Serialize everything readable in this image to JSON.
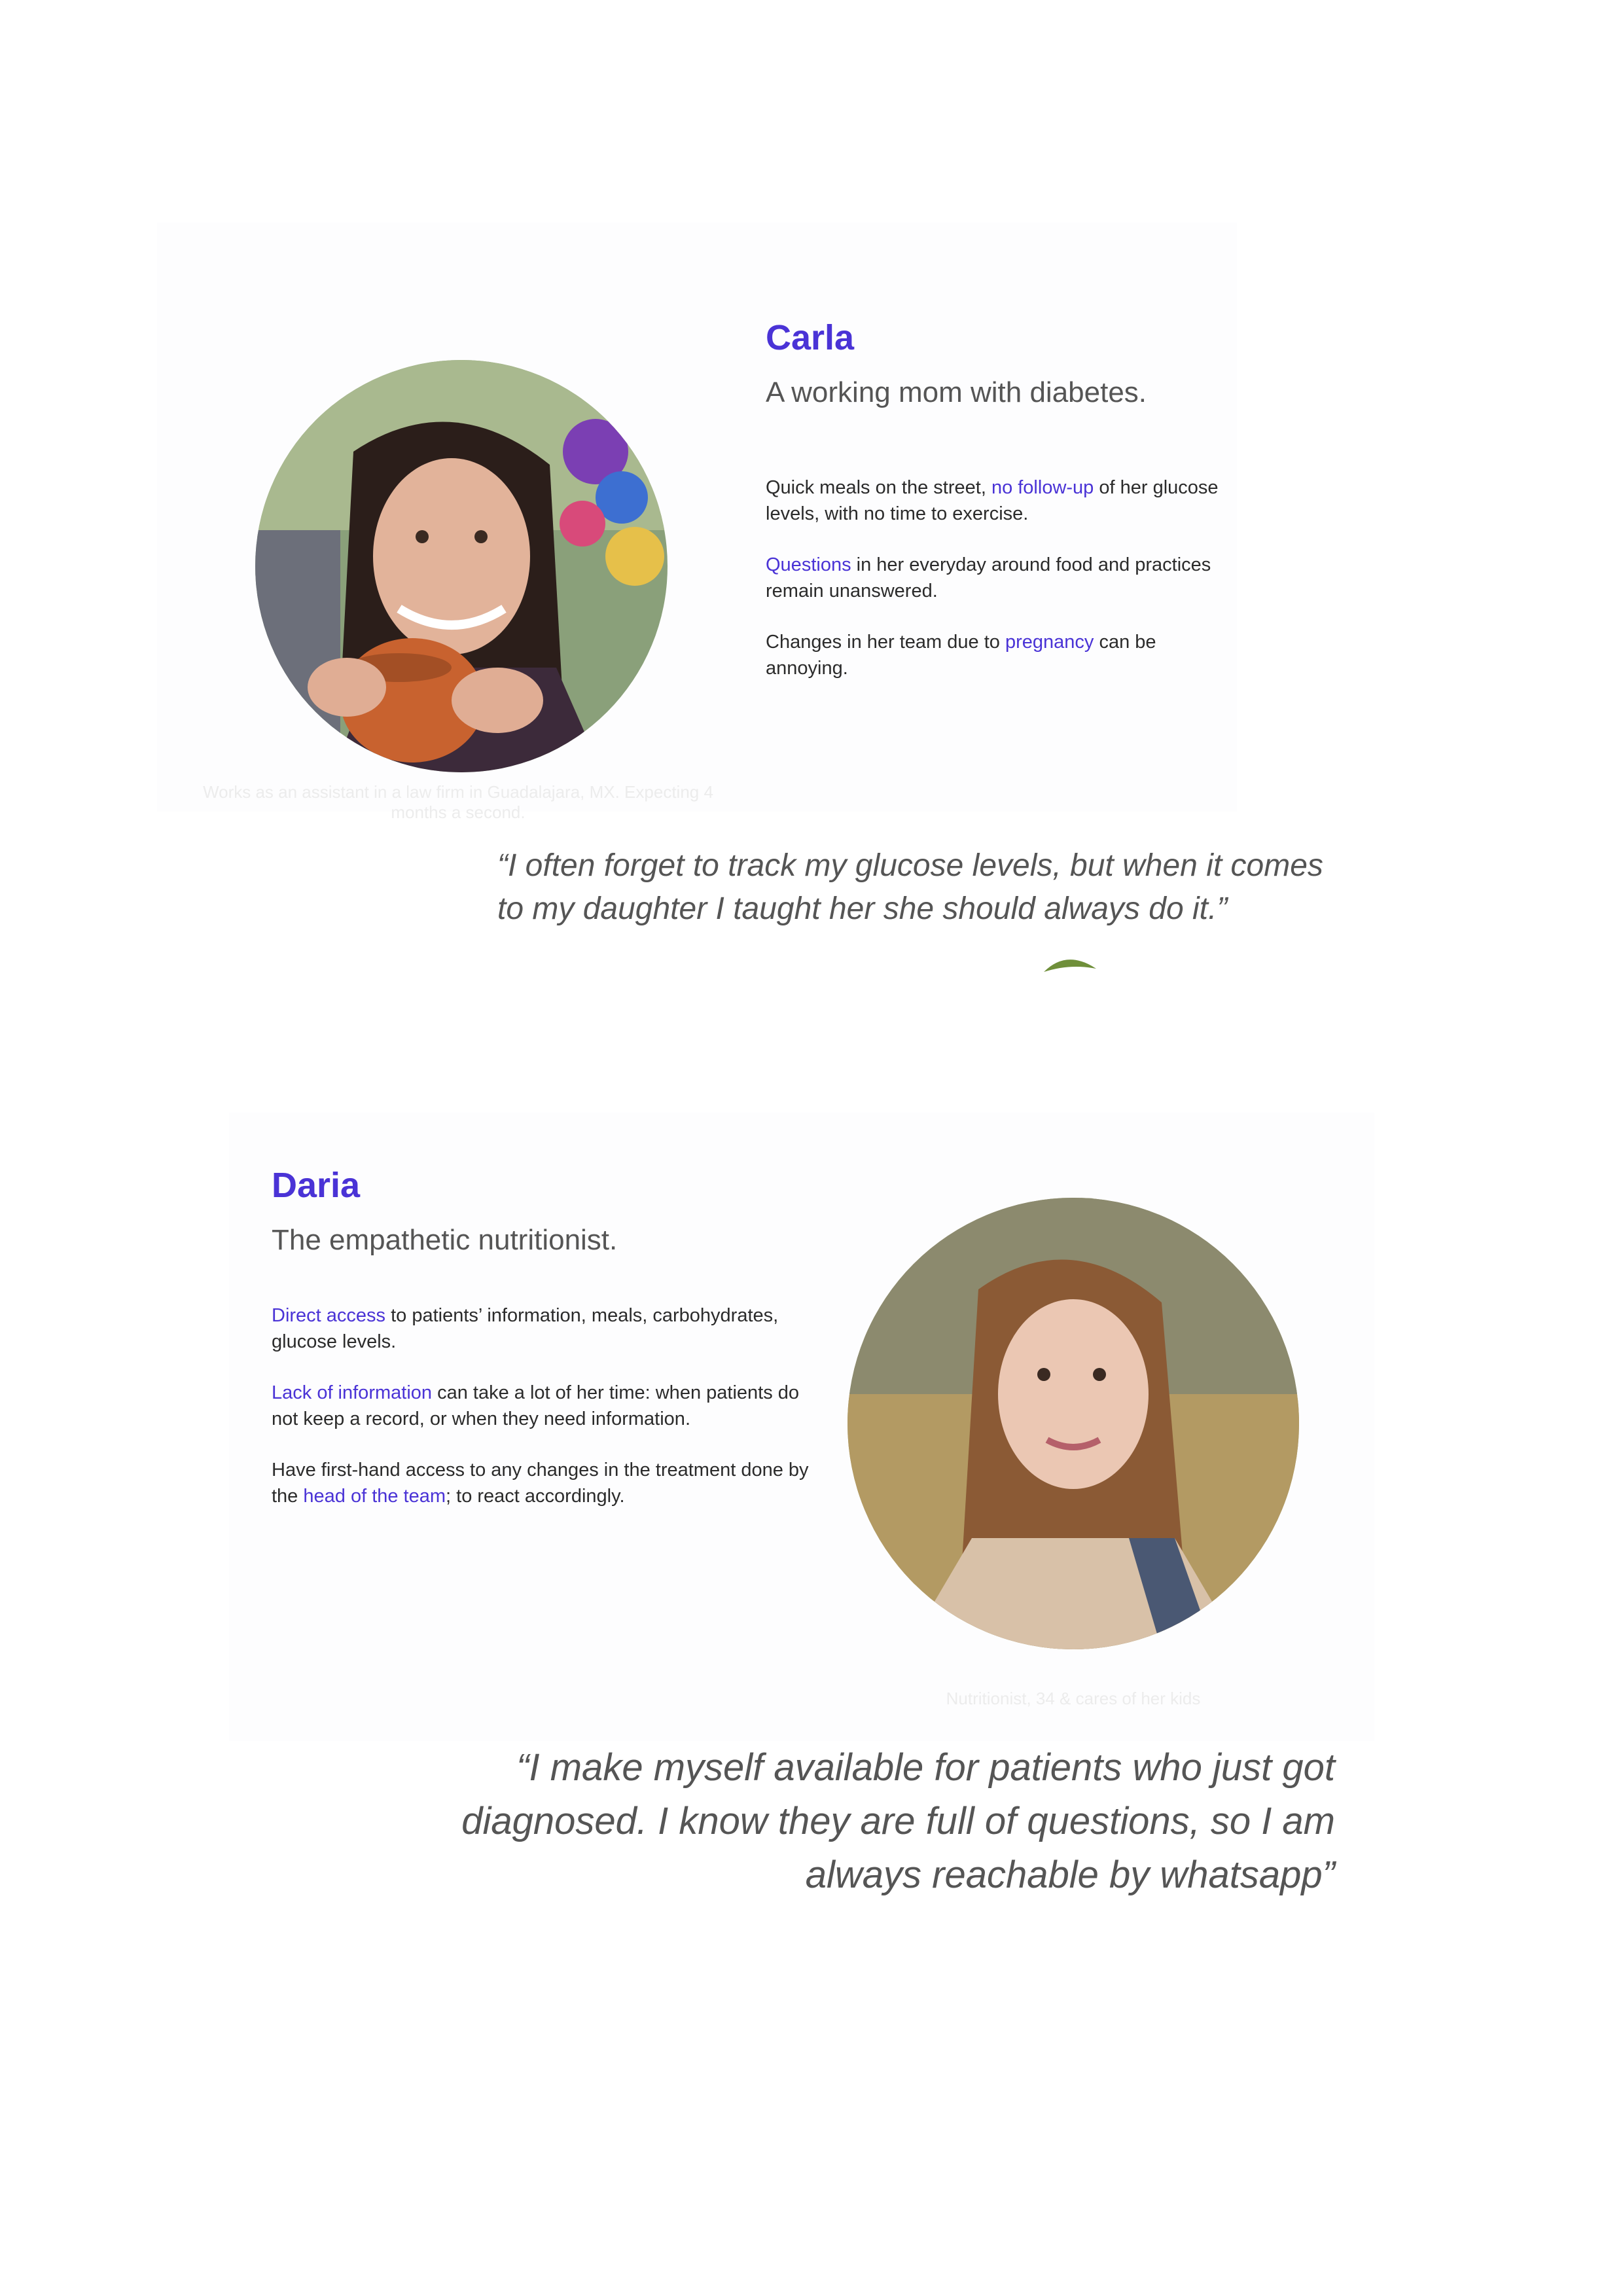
{
  "personas": [
    {
      "name": "Carla",
      "tagline": "A working mom with diabetes.",
      "points": [
        {
          "before": "Quick meals on the street, ",
          "highlight": "no follow-up",
          "after": " of her glucose levels, with no time to exercise."
        },
        {
          "before": "",
          "highlight": "Questions",
          "after": " in her everyday around food and practices remain unanswered."
        },
        {
          "before": "Changes in her team due to ",
          "highlight": "pregnancy",
          "after": " can be annoying."
        }
      ],
      "caption": "Works as an assistant in a law firm in Guadalajara, MX. Expecting 4 months a second.",
      "quote": "“I often forget to track my glucose levels, but when it comes to my daughter I taught her she should always do it.”"
    },
    {
      "name": "Daria",
      "tagline": "The empathetic nutritionist.",
      "points": [
        {
          "before": "",
          "highlight": "Direct access",
          "after": " to patients’ information, meals, carbohydrates, glucose levels."
        },
        {
          "before": "",
          "highlight": "Lack of information",
          "after": " can take a lot of her time: when patients do not keep a record, or when they need information."
        },
        {
          "before": "Have first-hand access to any changes in the treatment done by the ",
          "highlight": "head of the team",
          "after": "; to react accordingly."
        }
      ],
      "caption": "Nutritionist, 34 & cares of her kids",
      "quote": "“I make myself available for patients who just got diagnosed. I know they are full of questions, so I am always reachable by whatsapp”"
    }
  ],
  "colors": {
    "accent": "#4a33d6",
    "text": "#2b2b2b",
    "muted": "#555555"
  }
}
